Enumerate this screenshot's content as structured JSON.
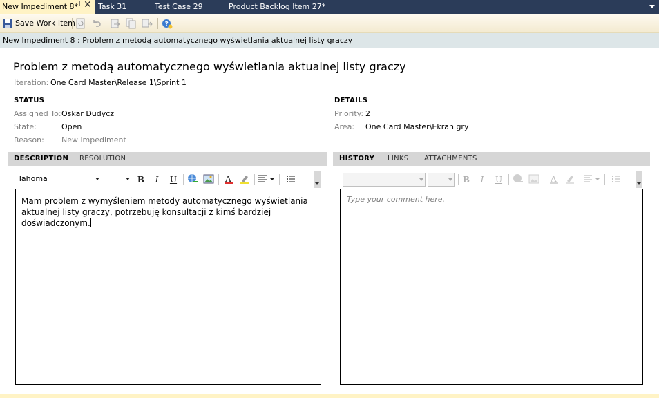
{
  "tabs": [
    {
      "label": "New Impediment 8*",
      "active": true
    },
    {
      "label": "Task 31",
      "active": false
    },
    {
      "label": "Test Case 29",
      "active": false
    },
    {
      "label": "Product Backlog Item 27*",
      "active": false
    }
  ],
  "toolbar": {
    "save_label": "Save Work Item",
    "icons": [
      "save-icon",
      "refresh-icon",
      "undo-icon",
      "new-linked-icon",
      "copy-icon",
      "link-icon",
      "help-icon"
    ]
  },
  "subtitle": "New Impediment 8 : Problem z metodą automatycznego wyświetlania aktualnej listy graczy",
  "work_item": {
    "title": "Problem z metodą automatycznego wyświetlania aktualnej listy graczy",
    "iteration_label": "Iteration:",
    "iteration_value": "One Card Master\\Release 1\\Sprint 1"
  },
  "status": {
    "heading": "STATUS",
    "assigned_label": "Assigned To:",
    "assigned_value": "Oskar Dudycz",
    "state_label": "State:",
    "state_value": "Open",
    "reason_label": "Reason:",
    "reason_value": "New impediment"
  },
  "details": {
    "heading": "DETAILS",
    "priority_label": "Priority:",
    "priority_value": "2",
    "area_label": "Area:",
    "area_value": "One Card Master\\Ekran gry"
  },
  "left_panel": {
    "tabs": [
      "DESCRIPTION",
      "RESOLUTION"
    ],
    "font_name": "Tahoma",
    "text": "Mam problem z wymyśleniem metody automatycznego wyświetlania aktualnej listy graczy, potrzebuję konsultacji z kimś bardziej doświadczonym."
  },
  "right_panel": {
    "tabs": [
      "HISTORY",
      "LINKS",
      "ATTACHMENTS"
    ],
    "placeholder": "Type your comment here."
  },
  "colors": {
    "tabstrip_bg": "#2b3c59",
    "active_tab_bg": "#fff3c5",
    "subtitle_bg": "#dde6e8",
    "panel_tab_bg": "#d6d6d6"
  }
}
